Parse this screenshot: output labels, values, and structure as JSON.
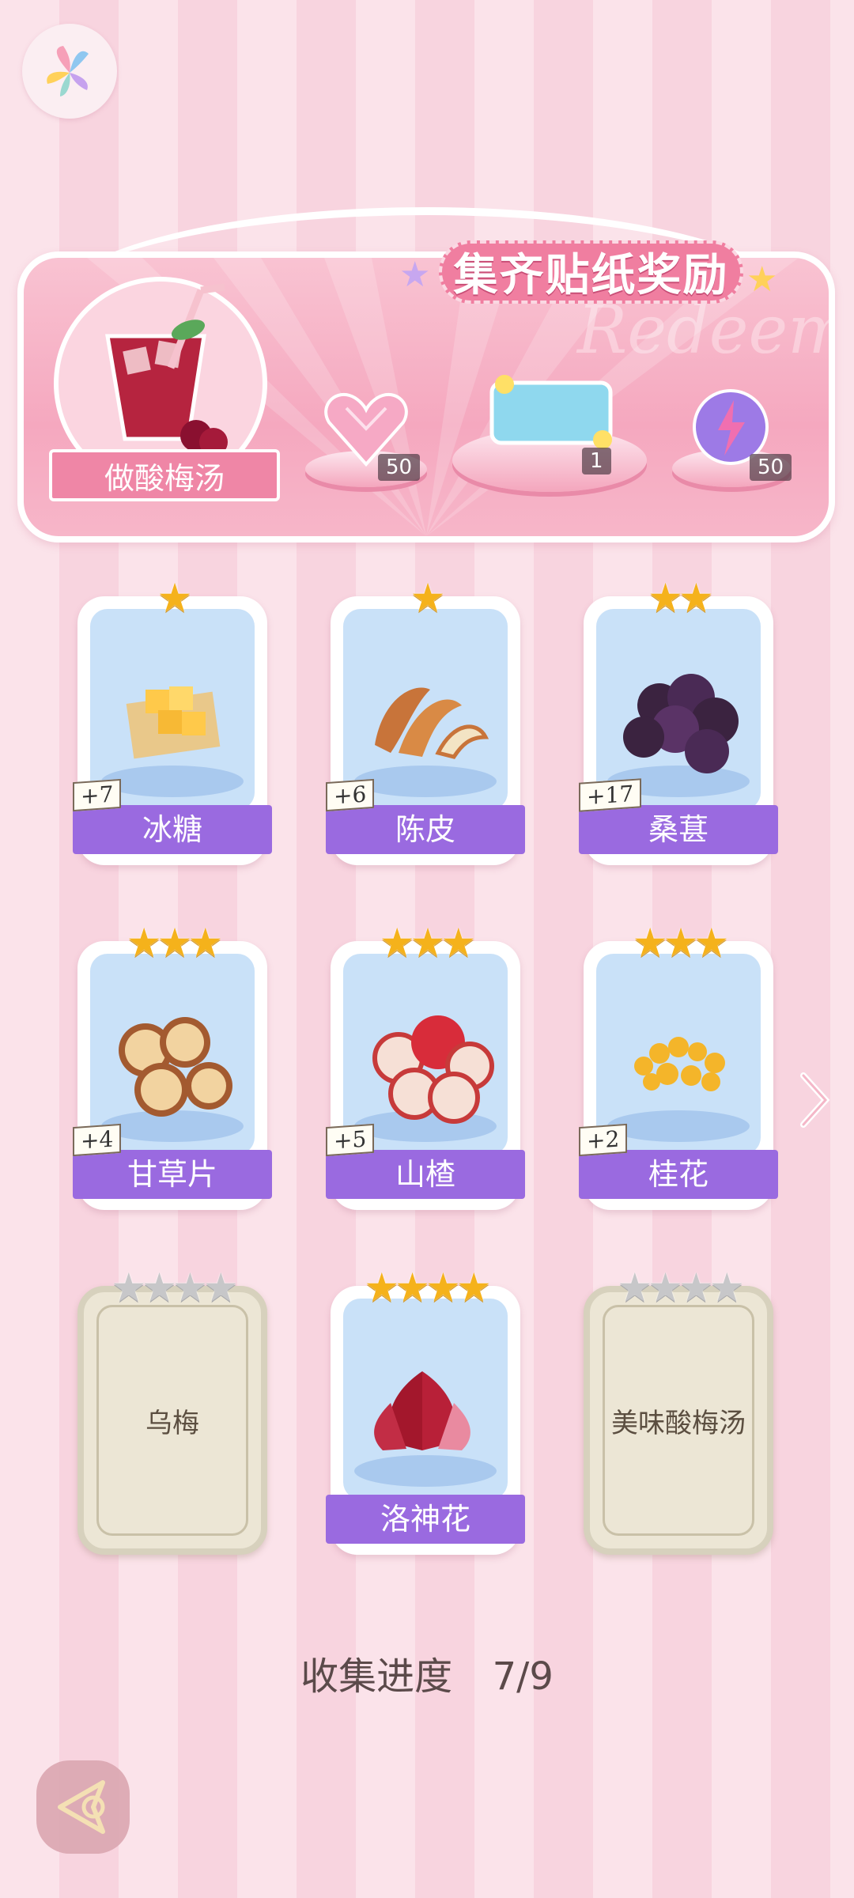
{
  "banner": {
    "title": "集齐贴纸奖励",
    "watermark": "Redeem",
    "drink_label": "做酸梅汤",
    "rewards": [
      {
        "icon": "pink-heart-gem-icon",
        "count": "50"
      },
      {
        "icon": "blue-card-icon",
        "count": "1"
      },
      {
        "icon": "energy-orb-icon",
        "count": "50"
      }
    ]
  },
  "stickers": [
    {
      "name": "冰糖",
      "stars": 1,
      "max_stars": 1,
      "bonus": "+7",
      "collected": true
    },
    {
      "name": "陈皮",
      "stars": 1,
      "max_stars": 1,
      "bonus": "+6",
      "collected": true
    },
    {
      "name": "桑葚",
      "stars": 2,
      "max_stars": 2,
      "bonus": "+17",
      "collected": true
    },
    {
      "name": "甘草片",
      "stars": 3,
      "max_stars": 3,
      "bonus": "+4",
      "collected": true
    },
    {
      "name": "山楂",
      "stars": 3,
      "max_stars": 3,
      "bonus": "+5",
      "collected": true
    },
    {
      "name": "桂花",
      "stars": 3,
      "max_stars": 3,
      "bonus": "+2",
      "collected": true
    },
    {
      "name": "乌梅",
      "stars": 0,
      "max_stars": 4,
      "bonus": "",
      "collected": false
    },
    {
      "name": "洛神花",
      "stars": 4,
      "max_stars": 4,
      "bonus": "",
      "collected": true
    },
    {
      "name": "美味酸梅汤",
      "stars": 0,
      "max_stars": 4,
      "bonus": "",
      "collected": false
    }
  ],
  "progress": {
    "label": "收集进度",
    "value": "7/9",
    "collected": 7,
    "total": 9
  },
  "colors": {
    "accent": "#9a6ae0",
    "banner": "#f5a8bf",
    "star": "#f5b21b"
  }
}
